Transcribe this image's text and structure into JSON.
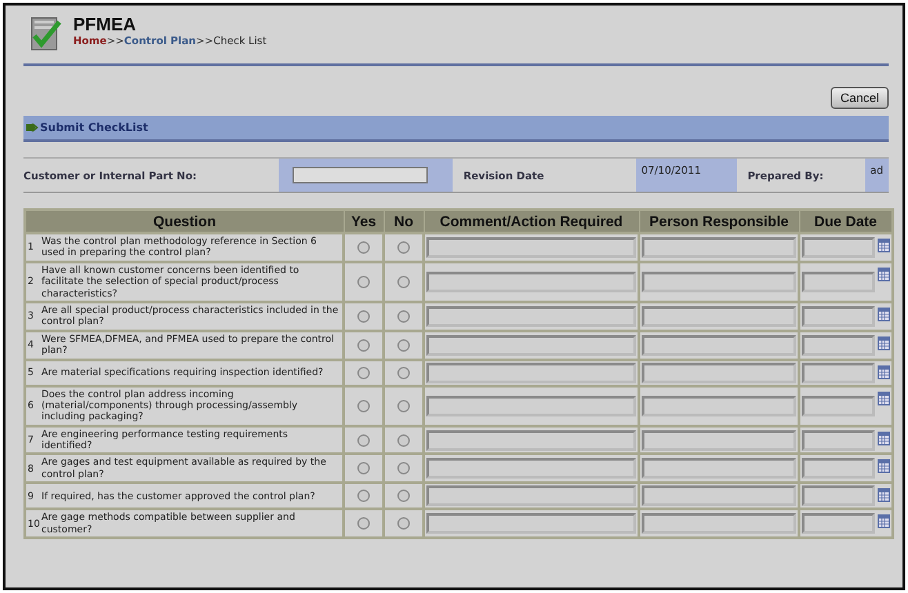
{
  "header": {
    "title": "PFMEA",
    "breadcrumb": [
      {
        "label": "Home",
        "kind": "home"
      },
      {
        "label": ">>",
        "kind": "sep"
      },
      {
        "label": "Control Plan",
        "kind": "link"
      },
      {
        "label": ">>",
        "kind": "sep"
      },
      {
        "label": "Check List",
        "kind": "current"
      }
    ]
  },
  "cancel_button": "Cancel",
  "submit_bar": {
    "label": "Submit CheckList"
  },
  "info": {
    "part_label": "Customer or Internal Part No:",
    "revision_label": "Revision Date",
    "revision_value": "07/10/2011",
    "prepared_label": "Prepared By:",
    "prepared_value": "ad"
  },
  "table": {
    "columns": [
      "Question",
      "Yes",
      "No",
      "Comment/Action Required",
      "Person Responsible",
      "Due Date"
    ],
    "rows": [
      {
        "num": "1",
        "question": "Was the control plan methodology reference in Section 6 used in preparing the control plan?",
        "yes": {
          "selected": false
        },
        "no": {
          "selected": false
        }
      },
      {
        "num": "2",
        "question": "Have all known customer concerns been identified to facilitate the selection of special product/process characteristics?",
        "yes": {
          "selected": false
        },
        "no": {
          "selected": false
        }
      },
      {
        "num": "3",
        "question": "Are all special product/process characteristics included in the control plan?",
        "yes": {
          "selected": false
        },
        "no": {
          "selected": false
        }
      },
      {
        "num": "4",
        "question": "Were SFMEA,DFMEA, and PFMEA used to prepare the control plan?",
        "yes": {
          "selected": false
        },
        "no": {
          "selected": false
        }
      },
      {
        "num": "5",
        "question": "Are material specifications requiring inspection identified?",
        "yes": {
          "selected": false
        },
        "no": {
          "selected": false
        }
      },
      {
        "num": "6",
        "question": "Does the control plan address incoming (material/components) through processing/assembly including packaging?",
        "yes": {
          "selected": false
        },
        "no": {
          "selected": false
        }
      },
      {
        "num": "7",
        "question": "Are engineering performance testing requirements identified?",
        "yes": {
          "selected": false
        },
        "no": {
          "selected": false
        }
      },
      {
        "num": "8",
        "question": "Are gages and test equipment available as required by the control plan?",
        "yes": {
          "selected": false
        },
        "no": {
          "selected": false
        }
      },
      {
        "num": "9",
        "question": "If required, has the customer approved the control plan?",
        "yes": {
          "selected": false
        },
        "no": {
          "selected": false
        }
      },
      {
        "num": "10",
        "question": "Are gage methods compatible between supplier and customer?",
        "yes": {
          "selected": false
        },
        "no": {
          "selected": false
        }
      }
    ]
  }
}
